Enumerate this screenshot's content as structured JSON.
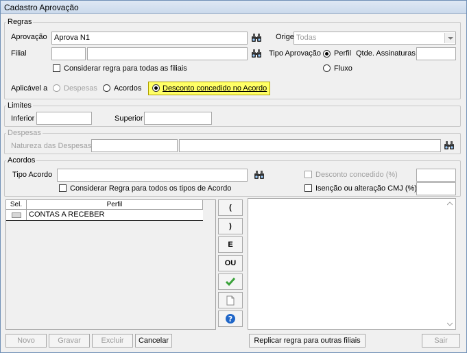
{
  "window": {
    "title": "Cadastro Aprovação"
  },
  "regras": {
    "legend": "Regras",
    "aprovacao_label": "Aprovação",
    "aprovacao_value": "Aprova N1",
    "origem_label": "Origem",
    "origem_value": "Todas",
    "filial_label": "Filial",
    "filial_code": "",
    "filial_name": "",
    "tipo_aprovacao_label": "Tipo Aprovação",
    "tipo_perfil": "Perfil",
    "tipo_fluxo": "Fluxo",
    "qtde_label": "Qtde. Assinaturas",
    "qtde_value": "",
    "todas_filiais_label": "Considerar regra para todas as filiais",
    "aplicavel_label": "Aplicável a",
    "opt_despesas": "Despesas",
    "opt_acordos": "Acordos",
    "opt_desconto": "Desconto concedido no Acordo"
  },
  "limites": {
    "legend": "Limites",
    "inferior_label": "Inferior",
    "inferior_value": "",
    "superior_label": "Superior",
    "superior_value": ""
  },
  "despesas": {
    "legend": "Despesas",
    "natureza_label": "Natureza das Despesas",
    "natureza_code": "",
    "natureza_name": ""
  },
  "acordos": {
    "legend": "Acordos",
    "tipo_label": "Tipo Acordo",
    "tipo_value": "",
    "desconto_label": "Desconto concedido (%)",
    "desconto_value": "",
    "todos_tipos_label": "Considerar Regra para todos os tipos de Acordo",
    "isencao_label": "Isenção ou alteração CMJ (%)",
    "isencao_value": ""
  },
  "grid": {
    "columns": [
      "Sel.",
      "Perfil"
    ],
    "rows": [
      {
        "perfil": "CONTAS A RECEBER"
      }
    ]
  },
  "side_buttons": {
    "open_paren": "(",
    "close_paren": ")",
    "and": "E",
    "or": "OU"
  },
  "footer": {
    "novo": "Novo",
    "gravar": "Gravar",
    "excluir": "Excluir",
    "cancelar": "Cancelar",
    "replicar": "Replicar regra para outras filiais",
    "sair": "Sair"
  }
}
